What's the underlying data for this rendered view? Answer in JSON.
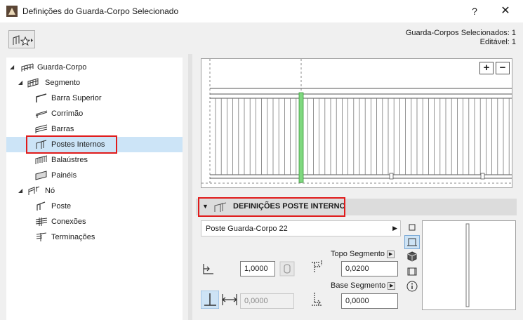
{
  "window": {
    "title": "Definições do Guarda-Corpo Selecionado",
    "help": "?",
    "close": "✕"
  },
  "selection_info": {
    "selected": "Guarda-Corpos Selecionados: 1",
    "editable": "Editável: 1"
  },
  "tree": {
    "root": "Guarda-Corpo",
    "segment": "Segmento",
    "top_rail": "Barra Superior",
    "handrail": "Corrimão",
    "rails": "Barras",
    "inner_posts": "Postes Internos",
    "balusters": "Balaústres",
    "panels": "Painéis",
    "node": "Nó",
    "post": "Poste",
    "connections": "Conexões",
    "end_finishes": "Terminações"
  },
  "preview": {
    "zoom_in": "+",
    "zoom_out": "−"
  },
  "panel": {
    "title": "DEFINIÇÕES POSTE INTERNO",
    "dropdown_value": "Poste Guarda-Corpo 22",
    "top_segment_label": "Topo Segmento",
    "base_segment_label": "Base Segmento",
    "spacing_value": "1,0000",
    "offset_value": "0,0000",
    "top_value": "0,0200",
    "base_value": "0,0000"
  },
  "colors": {
    "highlight_red": "#e01b1b",
    "selection_blue": "#cce4f7",
    "post_green": "#7fd87f"
  }
}
